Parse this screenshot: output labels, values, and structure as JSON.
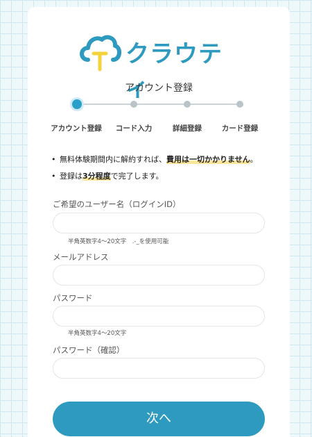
{
  "brand": {
    "name": "クラウティ",
    "color": "#2e9ac0",
    "accent": "#f4d23a"
  },
  "page_title": "アカウント登録",
  "steps": [
    {
      "label": "アカウント登録",
      "active": true
    },
    {
      "label": "コード入力",
      "active": false
    },
    {
      "label": "詳細登録",
      "active": false
    },
    {
      "label": "カード登録",
      "active": false
    }
  ],
  "notes": {
    "note1_a": "無料体験期間内に解約すれば、",
    "note1_b": "費用は一切かかりません",
    "note1_c": "。",
    "note2_a": "登録は",
    "note2_b": "3分程度",
    "note2_c": "で完了します。"
  },
  "form": {
    "username": {
      "label": "ご希望のユーザー名（ログインID）",
      "value": "",
      "hint": "半角英数字4～20文字　.-_を使用可能"
    },
    "email": {
      "label": "メールアドレス",
      "value": ""
    },
    "password": {
      "label": "パスワード",
      "value": "",
      "hint": "半角英数字4～20文字"
    },
    "password_confirm": {
      "label": "パスワード（確認）",
      "value": ""
    }
  },
  "next_label": "次へ"
}
